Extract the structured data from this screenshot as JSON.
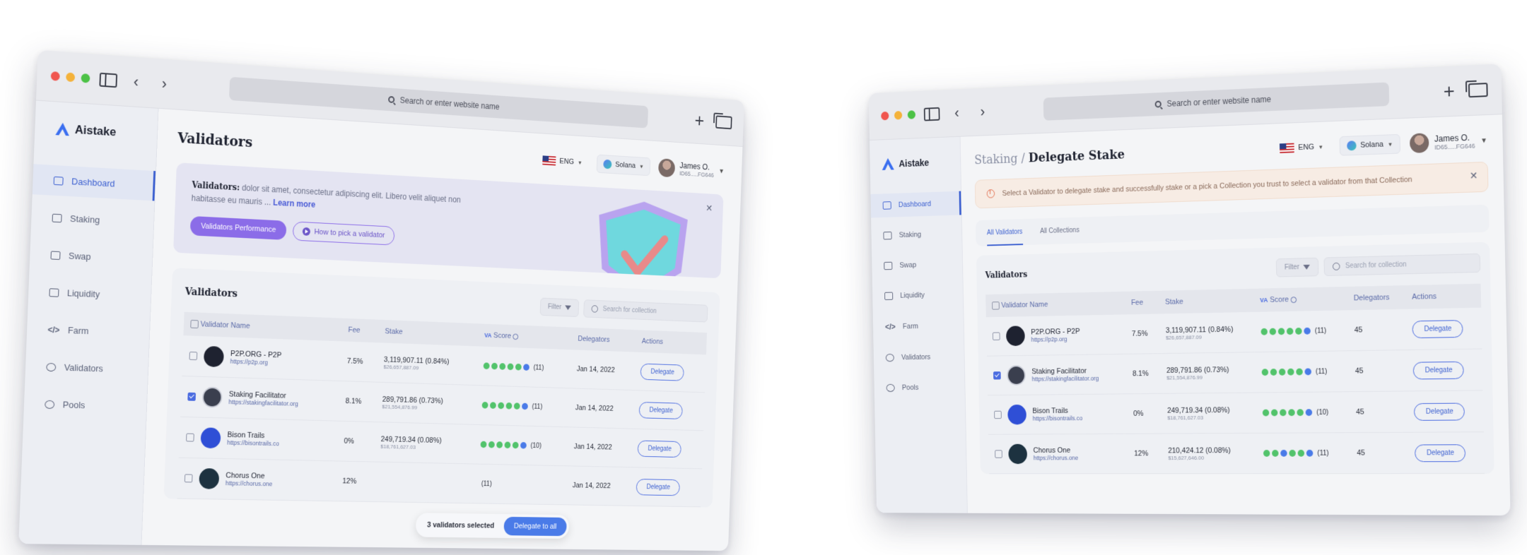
{
  "browser": {
    "url_placeholder": "Search or enter website name"
  },
  "brand": {
    "name": "Aistake",
    "accent": "#3b5fd0"
  },
  "nav": [
    {
      "label": "Dashboard",
      "icon": "dashboard-icon"
    },
    {
      "label": "Staking",
      "icon": "staking-icon"
    },
    {
      "label": "Swap",
      "icon": "swap-icon"
    },
    {
      "label": "Liquidity",
      "icon": "liquidity-icon"
    },
    {
      "label": "Farm",
      "icon": "code-icon"
    },
    {
      "label": "Validators",
      "icon": "validators-icon"
    },
    {
      "label": "Pools",
      "icon": "pools-icon"
    }
  ],
  "topbar": {
    "lang": "ENG",
    "network": "Solana",
    "user_name": "James O.",
    "user_id": "ID65.....FG646"
  },
  "left": {
    "page_title": "Validators",
    "banner": {
      "title": "Validators:",
      "text": "dolor sit amet, consectetur adipiscing elit. Libero velit aliquet non habitasse eu mauris ...",
      "learn_more": "Learn more",
      "primary_button": "Validators Performance",
      "secondary_button": "How to pick a validator"
    },
    "card_title": "Validators",
    "filter": "Filter",
    "search_placeholder": "Search for collection",
    "columns": {
      "name": "Validator Name",
      "fee": "Fee",
      "stake": "Stake",
      "score": "Score",
      "delegators": "Delegators",
      "actions": "Actions"
    },
    "rows": [
      {
        "name": "P2P.ORG - P2P",
        "url": "https://p2p.org",
        "fee": "7.5%",
        "stake": "3,119,907.11 (0.84%)",
        "stake_usd": "$26,657,887.09",
        "score_count": "(11)",
        "date": "Jan 14, 2022",
        "action": "Delegate",
        "checked": false
      },
      {
        "name": "Staking Facilitator",
        "url": "https://stakingfacilitator.org",
        "fee": "8.1%",
        "stake": "289,791.86 (0.73%)",
        "stake_usd": "$21,554,876.99",
        "score_count": "(11)",
        "date": "Jan 14, 2022",
        "action": "Delegate",
        "checked": true
      },
      {
        "name": "Bison Trails",
        "url": "https://bisontrails.co",
        "fee": "0%",
        "stake": "249,719.34 (0.08%)",
        "stake_usd": "$18,761,627.03",
        "score_count": "(10)",
        "date": "Jan 14, 2022",
        "action": "Delegate",
        "checked": false
      },
      {
        "name": "Chorus One",
        "url": "https://chorus.one",
        "fee": "12%",
        "stake": "",
        "stake_usd": "",
        "score_count": "(11)",
        "date": "Jan 14, 2022",
        "action": "Delegate",
        "checked": false
      }
    ],
    "selection": {
      "text": "3 validators selected",
      "button": "Delegate to all"
    }
  },
  "right": {
    "crumb_root": "Staking /",
    "crumb_current": "Delegate Stake",
    "alert": "Select a Validator to delegate stake and successfully stake or a pick a Collection you trust to select a validator from that Collection",
    "tabs": [
      "All Validators",
      "All Collections"
    ],
    "card_title": "Validators",
    "filter": "Filter",
    "search_placeholder": "Search for collection",
    "columns": {
      "name": "Validator Name",
      "fee": "Fee",
      "stake": "Stake",
      "score": "Score",
      "delegators": "Delegators",
      "actions": "Actions"
    },
    "rows": [
      {
        "name": "P2P.ORG - P2P",
        "url": "https://p2p.org",
        "fee": "7.5%",
        "stake": "3,119,907.11 (0.84%)",
        "stake_usd": "$26,657,887.09",
        "score_count": "(11)",
        "delegators": "45",
        "action": "Delegate",
        "checked": false
      },
      {
        "name": "Staking Facilitator",
        "url": "https://stakingfacilitator.org",
        "fee": "8.1%",
        "stake": "289,791.86 (0.73%)",
        "stake_usd": "$21,554,876.99",
        "score_count": "(11)",
        "delegators": "45",
        "action": "Delegate",
        "checked": true
      },
      {
        "name": "Bison Trails",
        "url": "https://bisontrails.co",
        "fee": "0%",
        "stake": "249,719.34 (0.08%)",
        "stake_usd": "$18,761,627.03",
        "score_count": "(10)",
        "delegators": "45",
        "action": "Delegate",
        "checked": false
      },
      {
        "name": "Chorus One",
        "url": "https://chorus.one",
        "fee": "12%",
        "stake": "210,424.12 (0.08%)",
        "stake_usd": "$15,627,646.00",
        "score_count": "(11)",
        "delegators": "45",
        "action": "Delegate",
        "checked": false
      }
    ]
  }
}
